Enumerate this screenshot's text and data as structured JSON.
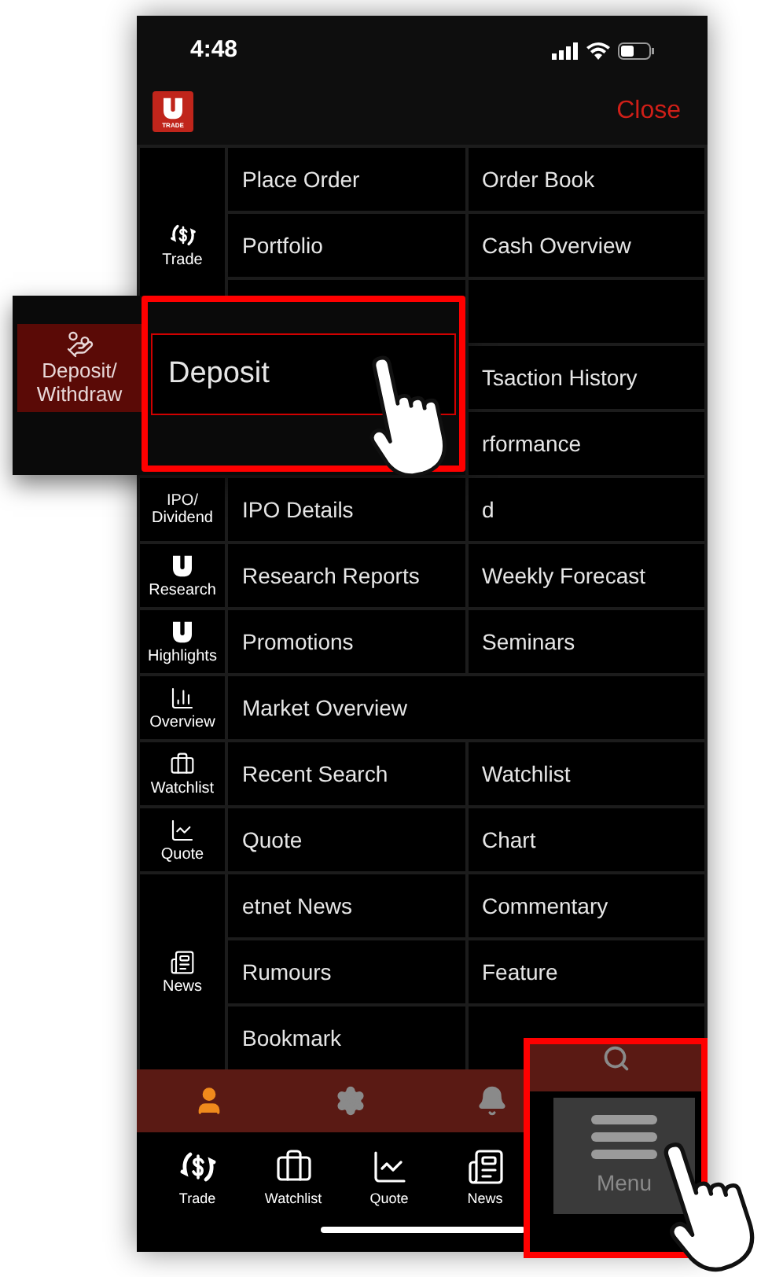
{
  "status_bar": {
    "time": "4:48"
  },
  "header": {
    "logo_caption": "TRADE",
    "close": "Close"
  },
  "sections": [
    {
      "kind": "trade",
      "label": "Trade",
      "rows": [
        {
          "cells": [
            {
              "text": "Place Order"
            },
            {
              "text": "Order Book"
            }
          ]
        },
        {
          "cells": [
            {
              "text": "Portfolio"
            },
            {
              "text": "Cash Overview"
            }
          ]
        },
        {
          "cells": [
            {},
            {}
          ]
        }
      ]
    },
    {
      "kind": "blank",
      "rows": [
        {
          "cells": [
            {},
            {
              "text": "Tsaction History"
            }
          ]
        },
        {
          "cells": [
            {},
            {
              "text": "rformance"
            }
          ]
        }
      ]
    },
    {
      "kind": "ipo",
      "label": "IPO/ Dividend",
      "rows": [
        {
          "cells": [
            {
              "text": "IPO Details"
            },
            {
              "text": "d"
            }
          ]
        }
      ]
    },
    {
      "kind": "research",
      "label": "Research",
      "rows": [
        {
          "cells": [
            {
              "text": "Research Reports"
            },
            {
              "text": "Weekly Forecast"
            }
          ]
        }
      ]
    },
    {
      "kind": "highlights",
      "label": "Highlights",
      "rows": [
        {
          "cells": [
            {
              "text": "Promotions"
            },
            {
              "text": "Seminars"
            }
          ]
        }
      ]
    },
    {
      "kind": "overview",
      "label": "Overview",
      "rows": [
        {
          "cells": [
            {
              "text": "Market Overview"
            }
          ]
        }
      ]
    },
    {
      "kind": "watchlist",
      "label": "Watchlist",
      "rows": [
        {
          "cells": [
            {
              "text": "Recent Search"
            },
            {
              "text": "Watchlist"
            }
          ]
        }
      ]
    },
    {
      "kind": "quote",
      "label": "Quote",
      "rows": [
        {
          "cells": [
            {
              "text": "Quote"
            },
            {
              "text": "Chart"
            }
          ]
        }
      ]
    },
    {
      "kind": "news",
      "label": "News",
      "rows": [
        {
          "cells": [
            {
              "text": "etnet News"
            },
            {
              "text": "Commentary"
            }
          ]
        },
        {
          "cells": [
            {
              "text": "Rumours"
            },
            {
              "text": "Feature"
            }
          ]
        },
        {
          "cells": [
            {
              "text": "Bookmark"
            },
            {}
          ]
        }
      ]
    }
  ],
  "toolbar": [
    {
      "kind": "person",
      "selected": true
    },
    {
      "kind": "settings",
      "selected": false
    },
    {
      "kind": "bell",
      "selected": false
    }
  ],
  "tab_bar": [
    {
      "kind": "trade",
      "label": "Trade"
    },
    {
      "kind": "watchlist",
      "label": "Watchlist"
    },
    {
      "kind": "quote",
      "label": "Quote"
    },
    {
      "kind": "news",
      "label": "News"
    }
  ],
  "deposit_callout": {
    "category_label": "Deposit/ Withdraw",
    "item_label": "Deposit"
  },
  "menu_callout": {
    "label": "Menu"
  }
}
